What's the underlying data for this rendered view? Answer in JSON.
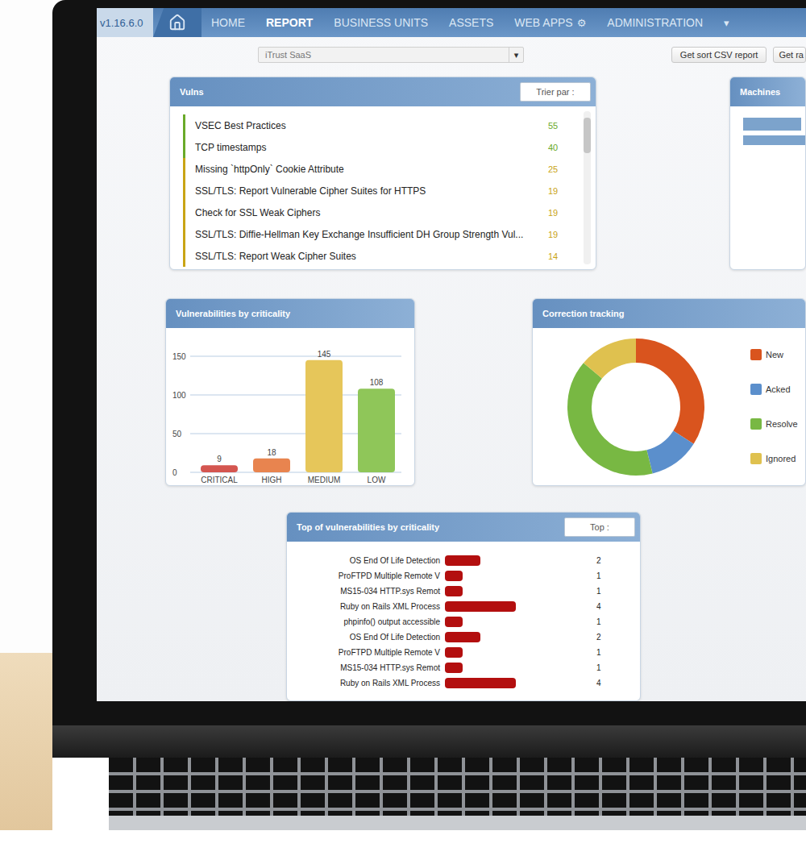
{
  "nav": {
    "version": "v1.16.6.0",
    "items": [
      {
        "label": "HOME",
        "selected": false
      },
      {
        "label": "REPORT",
        "selected": true
      },
      {
        "label": "BUSINESS UNITS",
        "selected": false
      },
      {
        "label": "ASSETS",
        "selected": false
      },
      {
        "label": "WEB APPS",
        "selected": false,
        "icon": "⚙"
      },
      {
        "label": "ADMINISTRATION",
        "selected": false
      }
    ],
    "more": "▾"
  },
  "toolbar": {
    "select": {
      "value": "iTrust SaaS",
      "arrow": "▾"
    },
    "buttons": [
      "Get sort CSV report",
      "Get ra"
    ]
  },
  "vulns": {
    "title": "Vulns",
    "sort_button": "Trier par :",
    "rows": [
      {
        "name": "VSEC Best Practices",
        "count": "55",
        "color": "#6aaa2a"
      },
      {
        "name": "TCP timestamps",
        "count": "40",
        "color": "#6aaa2a"
      },
      {
        "name": "Missing `httpOnly` Cookie Attribute",
        "count": "25",
        "color": "#c9a415"
      },
      {
        "name": "SSL/TLS: Report Vulnerable Cipher Suites for HTTPS",
        "count": "19",
        "color": "#c9a415"
      },
      {
        "name": "Check for SSL Weak Ciphers",
        "count": "19",
        "color": "#c9a415"
      },
      {
        "name": "SSL/TLS: Diffie-Hellman Key Exchange Insufficient DH Group Strength Vul...",
        "count": "19",
        "color": "#c9a415"
      },
      {
        "name": "SSL/TLS: Report Weak Cipher Suites",
        "count": "14",
        "color": "#c9a415"
      }
    ]
  },
  "machines": {
    "title": "Machines",
    "bars": [
      {
        "level": 0.94
      },
      {
        "level": 1
      }
    ]
  },
  "criticality": {
    "title": "Vulnerabilities by criticality",
    "ticks": [
      "150",
      "100",
      "50",
      "0"
    ],
    "categories": [
      "CRITICAL",
      "HIGH",
      "MEDIUM",
      "LOW"
    ],
    "values": [
      9,
      18,
      145,
      108
    ],
    "value_labels": [
      "9",
      "18",
      "145",
      "108"
    ],
    "colors": [
      "#d45650",
      "#e8844f",
      "#e6c65a",
      "#8fc659"
    ]
  },
  "correction": {
    "title": "Correction tracking",
    "values": [
      34,
      12,
      40,
      14
    ],
    "legend": [
      {
        "label": "New",
        "color": "#d9541e"
      },
      {
        "label": "Acked",
        "color": "#5b8fcc"
      },
      {
        "label": "Resolve",
        "color": "#78b843"
      },
      {
        "label": "Ignored",
        "color": "#dfc14f"
      }
    ]
  },
  "top": {
    "title": "Top of vulnerabilities by criticality",
    "button": "Top :",
    "rows": [
      {
        "name": "OS End Of Life Detection",
        "count": "2",
        "value": 2
      },
      {
        "name": "ProFTPD Multiple Remote V",
        "count": "1",
        "value": 1
      },
      {
        "name": "MS15-034 HTTP.sys Remot",
        "count": "1",
        "value": 1
      },
      {
        "name": "Ruby on Rails XML Process",
        "count": "4",
        "value": 4
      },
      {
        "name": "phpinfo() output accessible",
        "count": "1",
        "value": 1
      },
      {
        "name": "OS End Of Life Detection",
        "count": "2",
        "value": 2
      },
      {
        "name": "ProFTPD Multiple Remote V",
        "count": "1",
        "value": 1
      },
      {
        "name": "MS15-034 HTTP.sys Remot",
        "count": "1",
        "value": 1
      },
      {
        "name": "Ruby on Rails XML Process",
        "count": "4",
        "value": 4
      }
    ]
  }
}
